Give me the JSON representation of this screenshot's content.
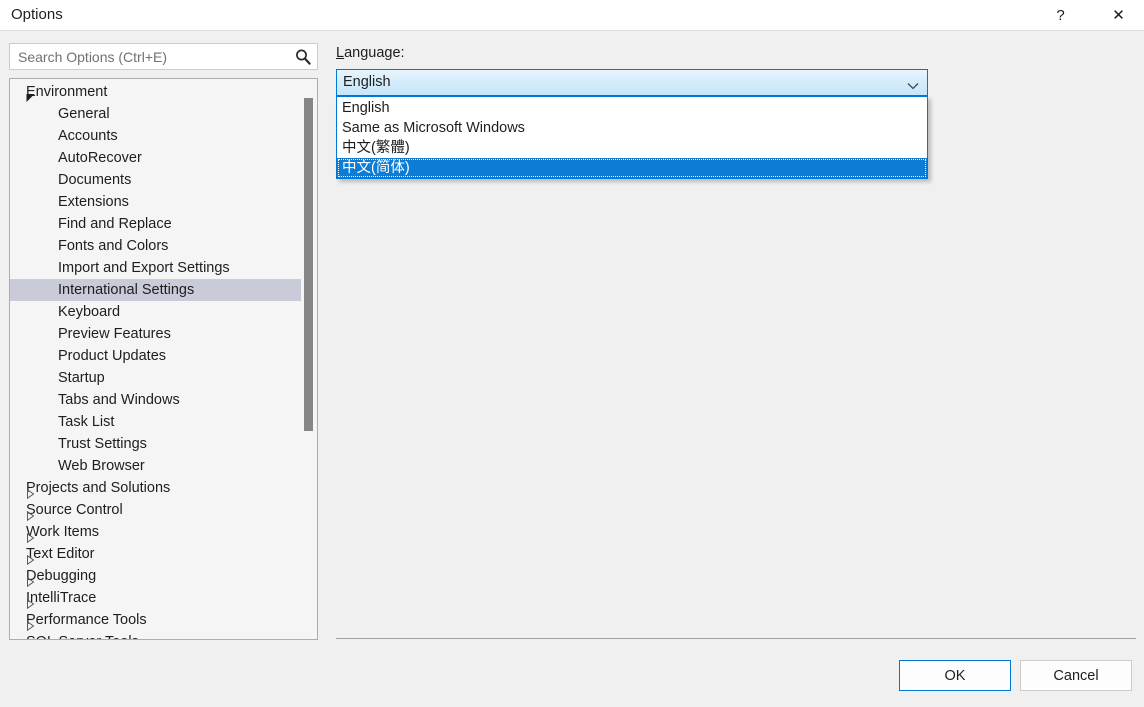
{
  "window": {
    "title": "Options",
    "help_glyph": "?",
    "close_glyph": "✕"
  },
  "search": {
    "placeholder": "Search Options (Ctrl+E)",
    "value": "",
    "icon": "search-icon"
  },
  "tree": {
    "items": [
      {
        "label": "Environment",
        "level": 1,
        "expander": "expanded",
        "selected": false
      },
      {
        "label": "General",
        "level": 2,
        "expander": "none",
        "selected": false
      },
      {
        "label": "Accounts",
        "level": 2,
        "expander": "none",
        "selected": false
      },
      {
        "label": "AutoRecover",
        "level": 2,
        "expander": "none",
        "selected": false
      },
      {
        "label": "Documents",
        "level": 2,
        "expander": "none",
        "selected": false
      },
      {
        "label": "Extensions",
        "level": 2,
        "expander": "none",
        "selected": false
      },
      {
        "label": "Find and Replace",
        "level": 2,
        "expander": "none",
        "selected": false
      },
      {
        "label": "Fonts and Colors",
        "level": 2,
        "expander": "none",
        "selected": false
      },
      {
        "label": "Import and Export Settings",
        "level": 2,
        "expander": "none",
        "selected": false
      },
      {
        "label": "International Settings",
        "level": 2,
        "expander": "none",
        "selected": true
      },
      {
        "label": "Keyboard",
        "level": 2,
        "expander": "none",
        "selected": false
      },
      {
        "label": "Preview Features",
        "level": 2,
        "expander": "none",
        "selected": false
      },
      {
        "label": "Product Updates",
        "level": 2,
        "expander": "none",
        "selected": false
      },
      {
        "label": "Startup",
        "level": 2,
        "expander": "none",
        "selected": false
      },
      {
        "label": "Tabs and Windows",
        "level": 2,
        "expander": "none",
        "selected": false
      },
      {
        "label": "Task List",
        "level": 2,
        "expander": "none",
        "selected": false
      },
      {
        "label": "Trust Settings",
        "level": 2,
        "expander": "none",
        "selected": false
      },
      {
        "label": "Web Browser",
        "level": 2,
        "expander": "none",
        "selected": false
      },
      {
        "label": "Projects and Solutions",
        "level": 1,
        "expander": "collapsed",
        "selected": false
      },
      {
        "label": "Source Control",
        "level": 1,
        "expander": "collapsed",
        "selected": false
      },
      {
        "label": "Work Items",
        "level": 1,
        "expander": "collapsed",
        "selected": false
      },
      {
        "label": "Text Editor",
        "level": 1,
        "expander": "collapsed",
        "selected": false
      },
      {
        "label": "Debugging",
        "level": 1,
        "expander": "collapsed",
        "selected": false
      },
      {
        "label": "IntelliTrace",
        "level": 1,
        "expander": "collapsed",
        "selected": false
      },
      {
        "label": "Performance Tools",
        "level": 1,
        "expander": "collapsed",
        "selected": false
      },
      {
        "label": "SQL Server Tools",
        "level": 1,
        "expander": "collapsed",
        "selected": false
      }
    ]
  },
  "settings_pane": {
    "language_label": "Language:",
    "language_label_accesskey": "L",
    "language_label_rest": "anguage:",
    "combo": {
      "selected_value": "English",
      "expanded": true,
      "options": [
        {
          "label": "English",
          "highlighted": false
        },
        {
          "label": "Same as Microsoft Windows",
          "highlighted": false
        },
        {
          "label": "中文(繁體)",
          "highlighted": false
        },
        {
          "label": "中文(简体)",
          "highlighted": true
        }
      ]
    }
  },
  "footer": {
    "ok_label": "OK",
    "cancel_label": "Cancel"
  },
  "colors": {
    "accent": "#0078d7",
    "highlight_blue": "#0c7cd5",
    "tree_selection": "#c9cbd9",
    "dialog_bg": "#f0f0f0",
    "titlebar_bg": "#ffffff"
  }
}
